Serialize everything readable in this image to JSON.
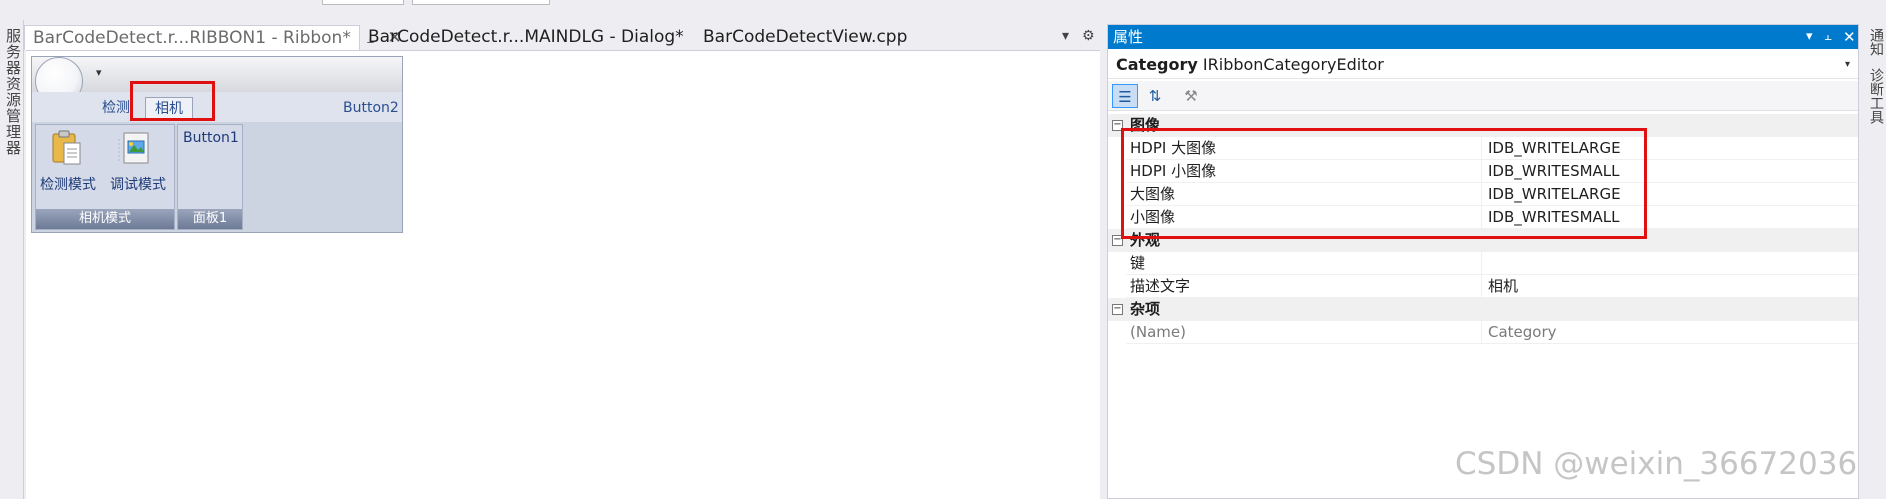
{
  "doc_tabs": [
    {
      "label": "BarCodeDetect.r...RIBBON1 - Ribbon*"
    },
    {
      "label": "BarCodeDetect.r...MAINDLG - Dialog*"
    },
    {
      "label": "BarCodeDetectView.cpp"
    }
  ],
  "left_strip": {
    "label": "服务器资源管理器"
  },
  "right_strip": {
    "items": [
      "通知",
      "诊断工具"
    ]
  },
  "ribbon": {
    "tabs": [
      {
        "label": "检测"
      },
      {
        "label": "相机"
      }
    ],
    "right_button": "Button2",
    "groups": [
      {
        "label": "相机模式",
        "buttons": [
          "检测模式",
          "调试模式"
        ]
      },
      {
        "label": "面板1",
        "buttons": [
          "Button1"
        ]
      }
    ]
  },
  "properties": {
    "title": "属性",
    "selected_name": "Category",
    "selected_type": "IRibbonCategoryEditor",
    "categories": [
      {
        "name": "图像",
        "rows": [
          {
            "name": "HDPI 大图像",
            "value": "IDB_WRITELARGE"
          },
          {
            "name": "HDPI 小图像",
            "value": "IDB_WRITESMALL"
          },
          {
            "name": "大图像",
            "value": "IDB_WRITELARGE"
          },
          {
            "name": "小图像",
            "value": "IDB_WRITESMALL"
          }
        ]
      },
      {
        "name": "外观",
        "rows": [
          {
            "name": "键",
            "value": ""
          },
          {
            "name": "描述文字",
            "value": "相机"
          }
        ]
      },
      {
        "name": "杂项",
        "rows": [
          {
            "name": "(Name)",
            "value": "Category"
          }
        ]
      }
    ]
  },
  "watermark": "CSDN @weixin_36672036",
  "icons": {
    "tab_pin": "pin-icon",
    "tab_close": "close-icon",
    "panel_pin": "pin-icon",
    "panel_close": "close-icon",
    "categorized": "categorized-icon",
    "alphabetical": "alphabetical-icon",
    "property_pages": "wrench-icon"
  },
  "colors": {
    "title_bar": "#007acc",
    "annotation": "#e01010"
  }
}
